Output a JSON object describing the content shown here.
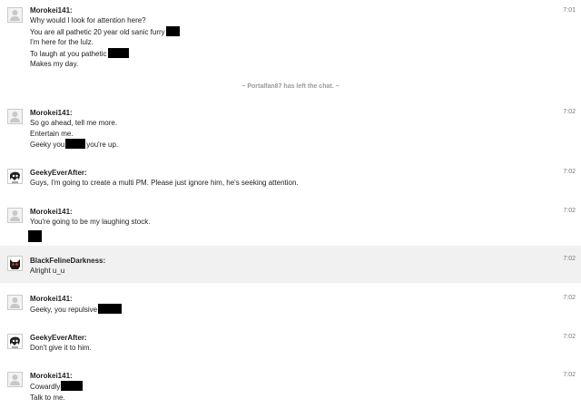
{
  "messages": [
    {
      "sender": "Morokei141:",
      "time": "7:01",
      "lines": [
        {
          "text": "Why would I look for attention here?",
          "after": ""
        },
        {
          "text": "You are all pathetic 20 year old sanic furry",
          "after": ""
        },
        {
          "text": "I'm here for the lulz.",
          "after": ""
        },
        {
          "text": "To laugh at you pathetic",
          "after": ""
        },
        {
          "text": "Makes my day.",
          "after": ""
        }
      ]
    },
    {
      "sender": "Morokei141:",
      "time": "7:02",
      "lines": [
        {
          "text": "So go ahead, tell me more.",
          "after": ""
        },
        {
          "text": "Entertain me.",
          "after": ""
        },
        {
          "text": "Geeky you",
          "after": "you're up."
        }
      ]
    },
    {
      "sender": "GeekyEverAfter:",
      "time": "7:02",
      "lines": [
        {
          "text": "Guys, I'm going to create a multi PM. Please just ignore him, he's seeking attention.",
          "after": ""
        }
      ]
    },
    {
      "sender": "Morokei141:",
      "time": "7:02",
      "lines": [
        {
          "text": "You're going to be my laughing stock.",
          "after": ""
        },
        {
          "text": "",
          "after": ""
        }
      ]
    },
    {
      "sender": "BlackFelineDarkness:",
      "time": "7:02",
      "lines": [
        {
          "text": "Alright u_u",
          "after": ""
        }
      ]
    },
    {
      "sender": "Morokei141:",
      "time": "7:02",
      "lines": [
        {
          "text": "Geeky, you repulsive",
          "after": ""
        }
      ]
    },
    {
      "sender": "GeekyEverAfter:",
      "time": "7:02",
      "lines": [
        {
          "text": "Don't give it to him.",
          "after": ""
        }
      ]
    },
    {
      "sender": "Morokei141:",
      "time": "7:02",
      "lines": [
        {
          "text": "Cowardly",
          "after": ""
        },
        {
          "text": "Talk to me.",
          "after": ""
        }
      ]
    }
  ],
  "system_notice": "~ Portalfan87 has left the chat. ~",
  "colors": {
    "highlight_row": "#f1f1f1",
    "redaction": "#000000",
    "timestamp": "#777777"
  }
}
